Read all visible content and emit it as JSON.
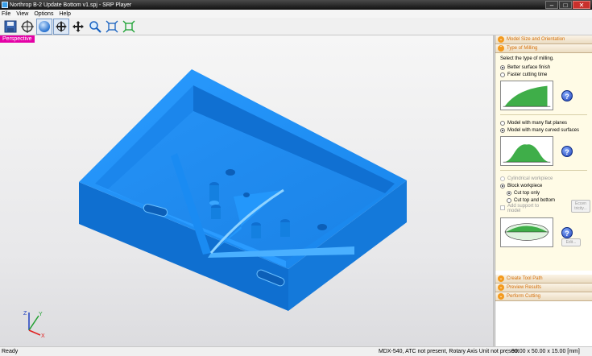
{
  "window": {
    "title": "Northrop B-2 Update Bottom v1.spj - SRP Player",
    "min": "–",
    "max": "□",
    "close": "✕"
  },
  "menu": [
    "File",
    "View",
    "Options",
    "Help"
  ],
  "toolbar": [
    {
      "icon": "save-icon"
    },
    {
      "icon": "crosshair-icon"
    },
    {
      "icon": "sphere-icon"
    },
    {
      "icon": "rotate-icon"
    },
    {
      "icon": "pan-icon"
    },
    {
      "icon": "zoom-icon"
    },
    {
      "icon": "fit-icon"
    },
    {
      "icon": "fit-all-icon"
    }
  ],
  "viewport": {
    "view_label": "Perspective",
    "axes": {
      "x": "X",
      "y": "Y",
      "z": "Z"
    }
  },
  "panel": {
    "sections": {
      "model_size": "Model Size and Orientation",
      "type_of_milling": "Type of Milling",
      "create_tool_path": "Create Tool Path",
      "preview_results": "Preview Results",
      "perform_cutting": "Perform Cutting"
    },
    "milling": {
      "prompt": "Select the type of milling.",
      "finish_options": [
        "Better surface finish",
        "Faster cutting time"
      ],
      "finish_selected": 0,
      "surface_options": [
        "Model with many flat planes",
        "Model with many curved surfaces"
      ],
      "surface_selected": 1,
      "workpiece_options": [
        "Cylindrical workpiece",
        "Block workpiece"
      ],
      "workpiece_selected": 1,
      "cut_options": [
        "Cut top only",
        "Cut top and bottom"
      ],
      "cut_selected": 0,
      "add_support_line1": "Add support to",
      "add_support_line2": "model",
      "eccentricity_line1": "Eccen",
      "eccentricity_line2": "tricity...",
      "edit": "Edit...",
      "help": "?"
    }
  },
  "status": {
    "ready": "Ready",
    "machine": "MDX-540, ATC not present, Rotary Axis Unit not present",
    "dimensions": "90.00 x 50.00 x 15.00 [mm]"
  },
  "colors": {
    "model": "#1e8ff0",
    "perspective_tag": "#e400a6",
    "accent": "#d4700a"
  }
}
